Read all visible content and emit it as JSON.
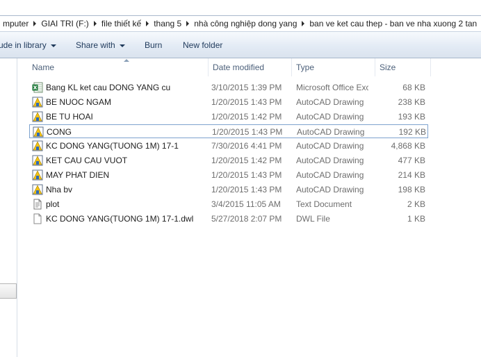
{
  "breadcrumb": {
    "segments": [
      "mputer",
      "GIAI TRI (F:)",
      "file thiết kế",
      "thang 5",
      "nhà công nghiệp dong yang",
      "ban ve ket cau thep - ban ve nha xuong 2 tan"
    ]
  },
  "toolbar": {
    "include_library": "ude in library",
    "share_with": "Share with",
    "burn": "Burn",
    "new_folder": "New folder"
  },
  "columns": {
    "name": "Name",
    "date": "Date modified",
    "type": "Type",
    "size": "Size"
  },
  "files": [
    {
      "name": "Bang KL ket cau DONG YANG cu",
      "date": "3/10/2015 1:39 PM",
      "type": "Microsoft Office Excel Worksheet",
      "size": "68 KB",
      "icon": "excel-icon"
    },
    {
      "name": "BE NUOC NGAM",
      "date": "1/20/2015 1:43 PM",
      "type": "AutoCAD Drawing",
      "size": "238 KB",
      "icon": "autocad-icon"
    },
    {
      "name": "BE TU HOAI",
      "date": "1/20/2015 1:42 PM",
      "type": "AutoCAD Drawing",
      "size": "193 KB",
      "icon": "autocad-icon"
    },
    {
      "name": "CONG",
      "date": "1/20/2015 1:43 PM",
      "type": "AutoCAD Drawing",
      "size": "192 KB",
      "icon": "autocad-icon"
    },
    {
      "name": "KC DONG YANG(TUONG 1M) 17-1",
      "date": "7/30/2016 4:41 PM",
      "type": "AutoCAD Drawing",
      "size": "4,868 KB",
      "icon": "autocad-icon"
    },
    {
      "name": "KET CAU CAU VUOT",
      "date": "1/20/2015 1:42 PM",
      "type": "AutoCAD Drawing",
      "size": "477 KB",
      "icon": "autocad-icon"
    },
    {
      "name": "MAY PHAT DIEN",
      "date": "1/20/2015 1:43 PM",
      "type": "AutoCAD Drawing",
      "size": "214 KB",
      "icon": "autocad-icon"
    },
    {
      "name": "Nha bv",
      "date": "1/20/2015 1:43 PM",
      "type": "AutoCAD Drawing",
      "size": "198 KB",
      "icon": "autocad-icon"
    },
    {
      "name": "plot",
      "date": "3/4/2015 11:05 AM",
      "type": "Text Document",
      "size": "2 KB",
      "icon": "text-file-icon"
    },
    {
      "name": "KC DONG YANG(TUONG 1M) 17-1.dwl",
      "date": "5/27/2018 2:07 PM",
      "type": "DWL File",
      "size": "1 KB",
      "icon": "blank-file-icon"
    }
  ],
  "colors": {
    "toolbar_text": "#1e395b",
    "header_text": "#4c607a",
    "focus_border": "#7da2ce",
    "excel_green": "#1f7a3a",
    "autocad_yellow": "#f3c316"
  }
}
